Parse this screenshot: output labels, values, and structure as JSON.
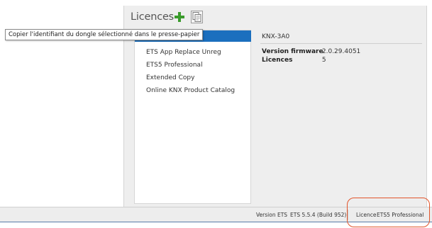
{
  "licences_panel": {
    "title": "Licences",
    "add_icon": "plus-icon",
    "copy_icon": "copy-to-clipboard-icon",
    "items": [
      "",
      "ETS App Replace Unreg",
      "ETS5 Professional",
      "Extended Copy",
      "Online KNX Product Catalog"
    ]
  },
  "tooltip": {
    "text": "Copier l'identifiant du dongle sélectionné dans le presse-papier"
  },
  "details": {
    "title": "KNX-3A0",
    "rows": [
      {
        "label": "Version firmware",
        "value": "2.0.29.4051"
      },
      {
        "label": "Licences",
        "value": "5"
      }
    ]
  },
  "statusbar": {
    "version_label": "Version ETS",
    "version_value": "ETS 5.5.4 (Build 952)",
    "licence_label": "Licence",
    "licence_value": "ETS5 Professional"
  },
  "colors": {
    "accent_selection": "#1b6fbe",
    "add_icon_green": "#3a9b2c",
    "highlight_orange": "#e2552b"
  }
}
